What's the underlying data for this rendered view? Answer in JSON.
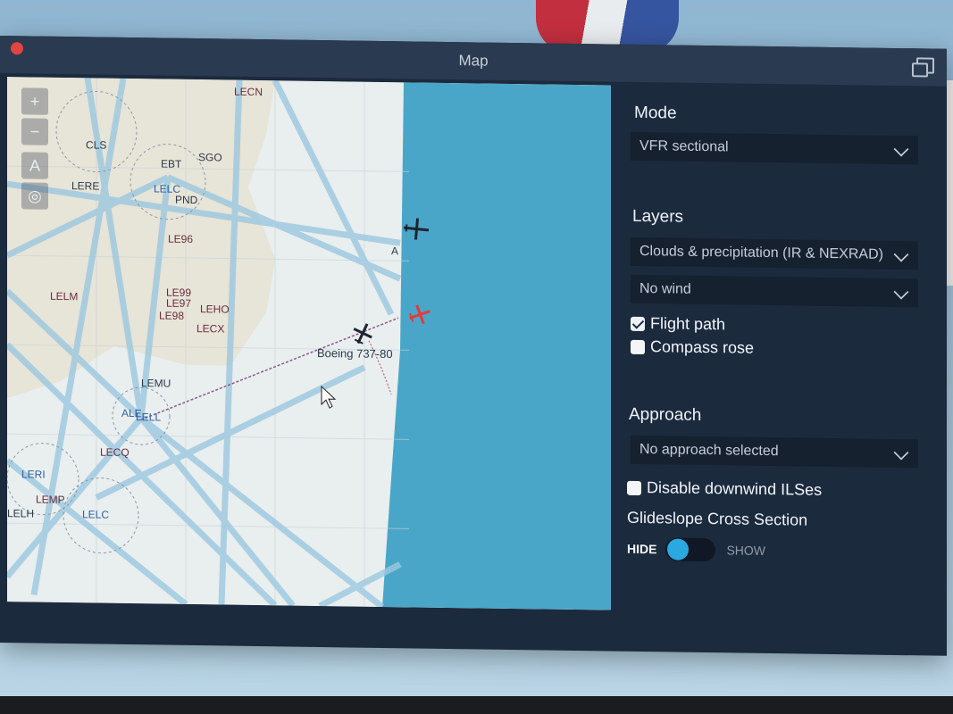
{
  "window": {
    "title": "Map"
  },
  "map": {
    "labels": {
      "lecn": "LECN",
      "cls": "CLS",
      "ebt": "EBT",
      "sgo": "SGO",
      "lere": "LERE",
      "lelc_top": "LELC",
      "pnd": "PND",
      "le96": "LE96",
      "lelm": "LELM",
      "le99": "LE99",
      "le97": "LE97",
      "le98": "LE98",
      "leho": "LEHO",
      "lecx": "LECX",
      "lemu": "LEMU",
      "lell": "LELL",
      "aleal": "ALE",
      "lecq": "LECQ",
      "leri": "LERI",
      "lemp": "LEMP",
      "lelh": "LELH",
      "lelc_bottom": "LELC",
      "a_mark": "A"
    },
    "aircraft_label": "Boeing 737-80",
    "zoom_in": "+",
    "zoom_out": "−",
    "text_tool": "A",
    "locate_tool": "◎"
  },
  "panel": {
    "mode_title": "Mode",
    "mode_value": "VFR sectional",
    "layers_title": "Layers",
    "layers_weather": "Clouds & precipitation (IR & NEXRAD)",
    "layers_wind": "No wind",
    "flight_path_label": "Flight path",
    "flight_path_checked": true,
    "compass_rose_label": "Compass rose",
    "compass_rose_checked": false,
    "approach_title": "Approach",
    "approach_value": "No approach selected",
    "disable_downwind_label": "Disable downwind ILSes",
    "disable_downwind_checked": false,
    "glideslope_title": "Glideslope Cross Section",
    "toggle_hide": "HIDE",
    "toggle_show": "SHOW",
    "glideslope_state": "HIDE"
  },
  "colors": {
    "panel_bg": "#1c2a3e",
    "sea": "#4aa6c8",
    "airway": "#9cc8e0",
    "accent": "#29a9e0",
    "own_aircraft": "#e23b3b"
  }
}
